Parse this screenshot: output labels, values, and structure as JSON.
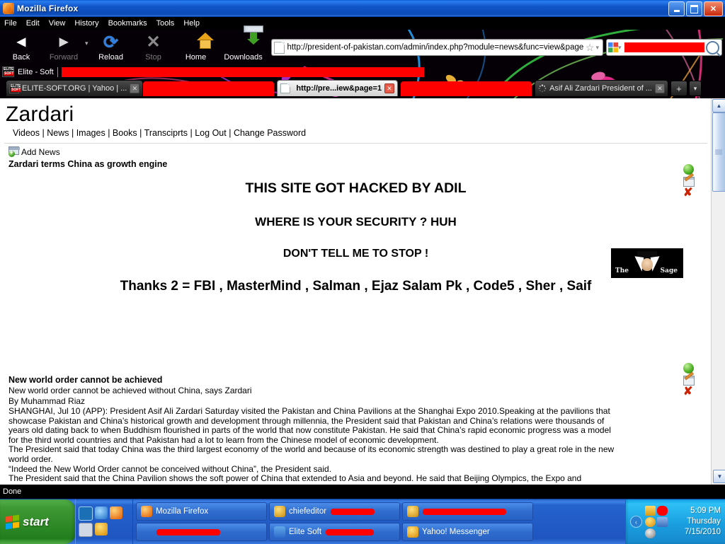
{
  "window": {
    "title": "Mozilla Firefox",
    "icon": "firefox-icon",
    "buttons": {
      "minimize": "_",
      "restore": "❐",
      "close": "✕"
    }
  },
  "menubar": {
    "items": [
      "File",
      "Edit",
      "View",
      "History",
      "Bookmarks",
      "Tools",
      "Help"
    ]
  },
  "toolbar": {
    "back": "Back",
    "forward": "Forward",
    "reload": "Reload",
    "stop": "Stop",
    "home": "Home",
    "downloads": "Downloads",
    "url": "http://president-of-pakistan.com/admin/index.php?module=news&func=view&page",
    "search_placeholder": "",
    "search_value": "",
    "star": "☆",
    "dropdown": "▾"
  },
  "bookmarks": {
    "items": [
      {
        "label": "Elite - Soft",
        "icon": "elite-soft-favicon"
      }
    ]
  },
  "tabs": [
    {
      "label": "ELITE-SOFT.ORG | Yahoo | ...",
      "active": false,
      "redacted": false,
      "close": "✕"
    },
    {
      "label": "",
      "active": false,
      "redacted": true,
      "close": ""
    },
    {
      "label": "http://pre...iew&page=1",
      "active": true,
      "redacted": false,
      "close": "✕"
    },
    {
      "label": "",
      "active": false,
      "redacted": true,
      "close": ""
    },
    {
      "label": "Asif Ali Zardari President of ...",
      "active": false,
      "redacted": false,
      "close": "✕"
    }
  ],
  "tab_controls": {
    "new_tab": "+",
    "list_all": "▾"
  },
  "page": {
    "site_title": "Zardari",
    "nav_links": [
      "Videos",
      "News",
      "Images",
      "Books",
      "Transciprts",
      "Log Out",
      "Change Password"
    ],
    "nav_separator": "|",
    "add_news": "Add News",
    "news_headline": "Zardari terms China as growth engine",
    "defacement": [
      "THIS SITE GOT HACKED BY ADIL",
      "WHERE IS YOUR SECURITY ? HUH",
      "DON'T TELL ME TO STOP !",
      "Thanks 2 = FBI , MasterMind , Salman , Ejaz Salam Pk , Code5 , Sher , Saif"
    ],
    "banner_image": {
      "alt": "the-sage-banner",
      "text_left": "The",
      "text_right": "Sage"
    },
    "row_icons": [
      "status-green-icon",
      "edit-icon",
      "delete-icon"
    ],
    "article": {
      "title": "New world order cannot be achieved",
      "subtitle": "New world order cannot be achieved without China, says Zardari",
      "byline": "By Muhammad Riaz",
      "paragraphs": [
        "SHANGHAI, Jul 10 (APP): President Asif Ali Zardari Saturday visited the Pakistan and China Pavilions at the Shanghai Expo 2010.Speaking at the pavilions that showcase Pakistan and China’s historical growth and development through millennia, the President said that Pakistan and China’s relations were thousands of years old dating back to when Buddhism flourished in parts of the world that now constitute Pakistan. He said that China’s rapid economic progress was a model for the third world countries and that Pakistan had a lot to learn from the Chinese model of economic development.",
        "The President said that today China was the third largest economy of the world and because of its economic strength was destined to play a great role in the new world order.",
        "“Indeed the New World Order cannot be conceived without China”, the President said.",
        "The President said that the China Pavilion shows the soft power of China that extended to Asia and beyond. He said that Beijing Olympics, the Expo and forthcoming Asian Games are great examples of China’s soft power."
      ]
    },
    "scrollbar": {
      "up": "▲",
      "down": "▼"
    }
  },
  "status_bar": {
    "text": "Done"
  },
  "taskbar": {
    "start_label": "start",
    "quick_launch": [
      "media-player-icon",
      "internet-explorer-icon",
      "firefox-icon",
      "show-desktop-icon",
      "yahoo-messenger-icon"
    ],
    "tasks": [
      {
        "label": "Mozilla Firefox",
        "icon": "firefox-icon",
        "redacted": false,
        "active": true
      },
      {
        "label": "chiefeditor",
        "icon": "messenger-icon",
        "redacted": true,
        "active": false
      },
      {
        "label": "",
        "icon": "messenger-icon",
        "redacted": true,
        "active": false
      },
      {
        "label": "",
        "icon": "none",
        "redacted": true,
        "active": false
      },
      {
        "label": "Elite Soft",
        "icon": "elite-soft-icon",
        "redacted": true,
        "active": false
      },
      {
        "label": "Yahoo! Messenger",
        "icon": "yahoo-messenger-icon",
        "redacted": false,
        "active": false
      }
    ],
    "tray": {
      "arrow": "‹",
      "icons": [
        "mail-icon",
        "redacted-icon",
        "yahoo-messenger-icon",
        "network-icon",
        "avg-icon"
      ],
      "time": "5:09 PM",
      "day": "Thursday",
      "date": "7/15/2010"
    }
  },
  "colors": {
    "redaction": "#fe0000",
    "titlebar_blue": "#1055c8",
    "taskbar_blue": "#2563cd",
    "start_green": "#2f8a27",
    "tray_blue": "#1a9fe0"
  }
}
